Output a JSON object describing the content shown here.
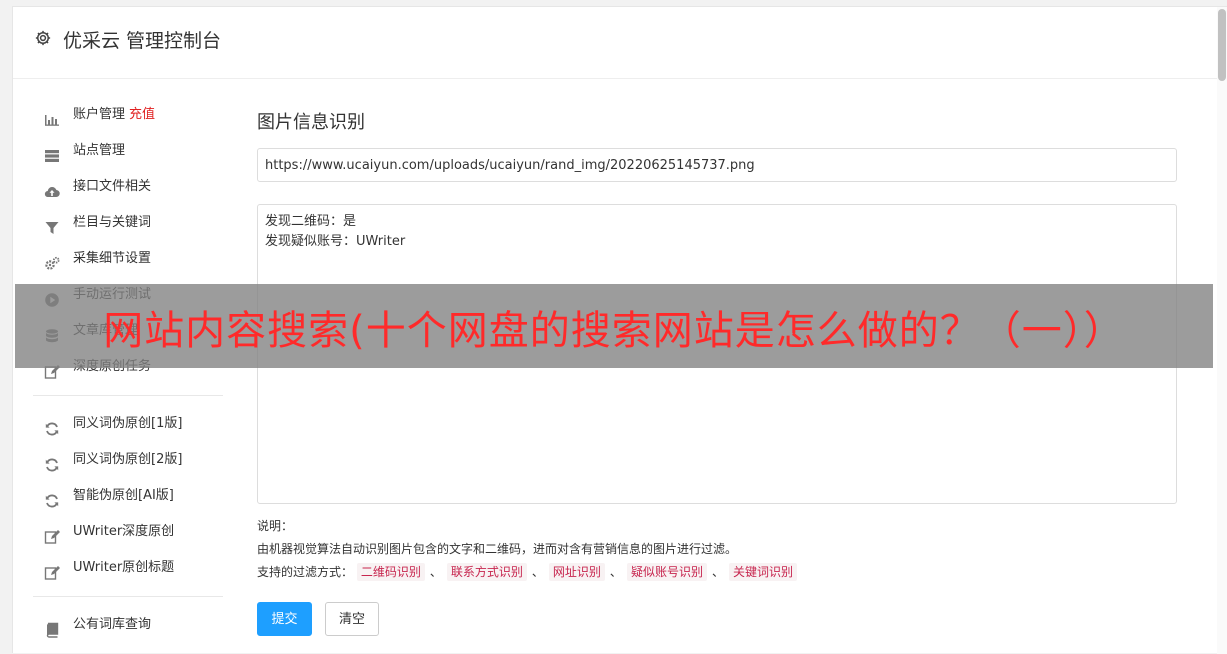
{
  "header": {
    "title": "优采云 管理控制台",
    "icon": "gear-icon"
  },
  "sidebar": {
    "group1": [
      {
        "label": "账户管理",
        "extra": "充值",
        "icon": "bar-chart-icon"
      },
      {
        "label": "站点管理",
        "icon": "server-icon"
      },
      {
        "label": "接口文件相关",
        "icon": "cloud-upload-icon"
      },
      {
        "label": "栏目与关键词",
        "icon": "filter-icon"
      },
      {
        "label": "采集细节设置",
        "icon": "gears-icon"
      },
      {
        "label": "手动运行测试",
        "icon": "play-circle-icon"
      },
      {
        "label": "文章库管理",
        "icon": "database-icon"
      },
      {
        "label": "深度原创任务",
        "icon": "edit-icon"
      }
    ],
    "group2": [
      {
        "label": "同义词伪原创[1版]",
        "icon": "refresh-icon"
      },
      {
        "label": "同义词伪原创[2版]",
        "icon": "refresh-icon"
      },
      {
        "label": "智能伪原创[AI版]",
        "icon": "refresh-icon"
      },
      {
        "label": "UWriter深度原创",
        "icon": "edit-icon"
      },
      {
        "label": "UWriter原创标题",
        "icon": "edit-icon"
      }
    ],
    "group3": [
      {
        "label": "公有词库查询",
        "icon": "book-icon"
      }
    ]
  },
  "main": {
    "section_title": "图片信息识别",
    "url_value": "https://www.ucaiyun.com/uploads/ucaiyun/rand_img/20220625145737.png",
    "result_lines": [
      "发现二维码：是",
      "发现疑似账号：UWriter"
    ],
    "desc_title": "说明：",
    "desc_text": "由机器视觉算法自动识别图片包含的文字和二维码，进而对含有营销信息的图片进行过滤。",
    "filter_label": "支持的过滤方式：",
    "filter_tags": [
      "二维码识别",
      "联系方式识别",
      "网址识别",
      "疑似账号识别",
      "关键词识别"
    ],
    "filter_sep": "、",
    "submit_label": "提交",
    "clear_label": "清空"
  },
  "banner": {
    "text": "网站内容搜索(十个网盘的搜索网站是怎么做的？（一））"
  },
  "colors": {
    "primary": "#1e9fff",
    "tag_text": "#c7254e",
    "tag_bg": "#f8f2f3",
    "banner_text": "#ff2a2a",
    "recharge": "#e02020"
  }
}
